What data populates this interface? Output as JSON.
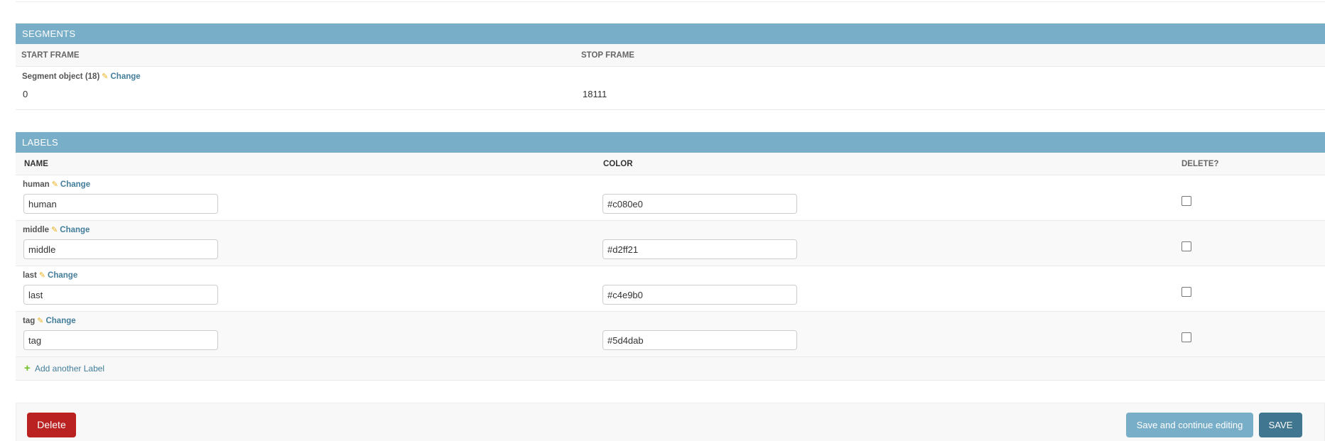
{
  "segments": {
    "caption": "SEGMENTS",
    "columns": [
      "START FRAME",
      "STOP FRAME"
    ],
    "rows": [
      {
        "original": "Segment object (18)",
        "change_label": "Change",
        "start_frame": "0",
        "stop_frame": "18111"
      }
    ]
  },
  "labels": {
    "caption": "LABELS",
    "columns": [
      "NAME",
      "COLOR",
      "DELETE?"
    ],
    "rows": [
      {
        "original": "human",
        "change_label": "Change",
        "name": "human",
        "color": "#c080e0",
        "delete": false
      },
      {
        "original": "middle",
        "change_label": "Change",
        "name": "middle",
        "color": "#d2ff21",
        "delete": false
      },
      {
        "original": "last",
        "change_label": "Change",
        "name": "last",
        "color": "#c4e9b0",
        "delete": false
      },
      {
        "original": "tag",
        "change_label": "Change",
        "name": "tag",
        "color": "#5d4dab",
        "delete": false
      }
    ],
    "add_another": "Add another Label"
  },
  "submit": {
    "delete_label": "Delete",
    "continue_label": "Save and continue editing",
    "save_label": "SAVE"
  },
  "icons": {
    "change": "pencil-icon",
    "add": "plus-icon"
  },
  "colors": {
    "header": "#79aec8",
    "link": "#447e9b",
    "delete_button": "#ba2121",
    "save_button": "#417690",
    "continue_button": "#79aec8",
    "add_icon": "#70bf2b"
  }
}
